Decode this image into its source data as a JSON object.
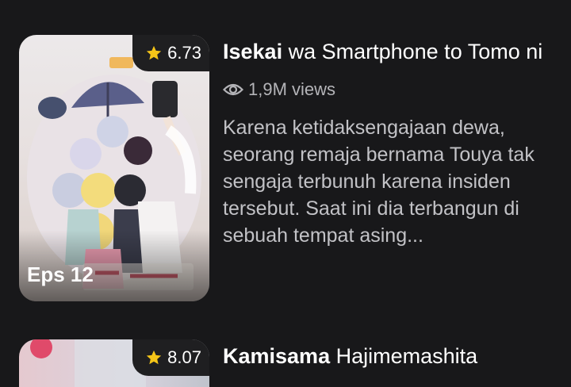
{
  "items": [
    {
      "rating": "6.73",
      "episode": "Eps 12",
      "title_bold": "Isekai",
      "title_rest": " wa Smartphone to Tomo ni",
      "views": "1,9M views",
      "synopsis": "Karena ketidaksengajaan dewa, seorang remaja bernama Touya tak sengaja terbunuh karena insiden tersebut. Saat ini dia terbangun di sebuah tempat asing..."
    },
    {
      "rating": "8.07",
      "title_bold": "Kamisama",
      "title_rest": " Hajimemashita"
    }
  ],
  "colors": {
    "background": "#18181a",
    "star": "#f5c518",
    "muted": "#b4b4b8"
  },
  "icons": {
    "rating": "star-icon",
    "views": "eye-icon"
  }
}
